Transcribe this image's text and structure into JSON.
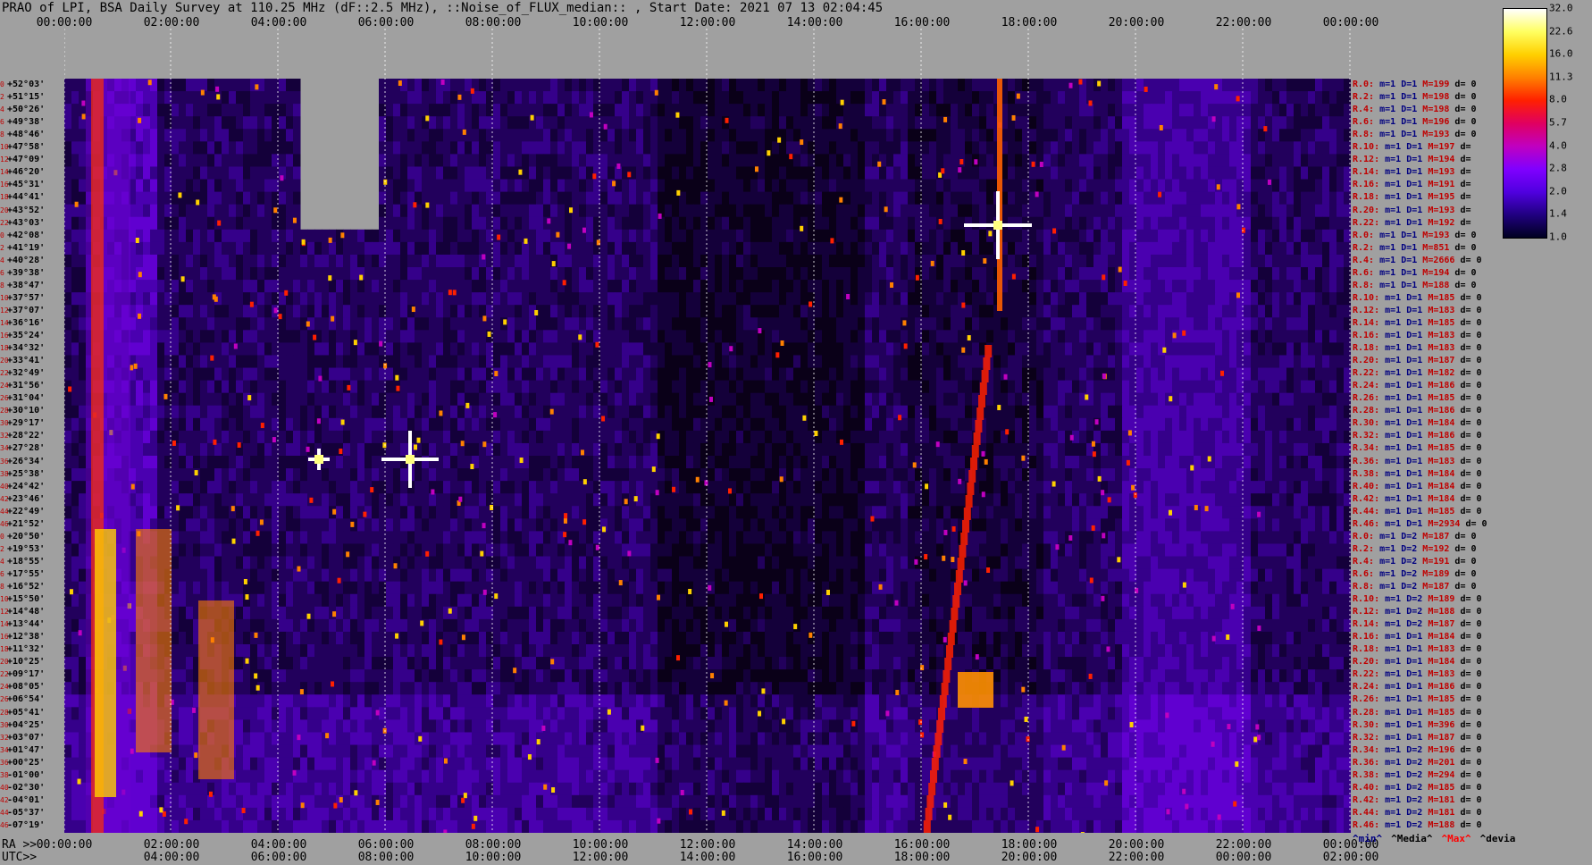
{
  "title": "PRAO of LPI, BSA Daily Survey at 110.25 MHz (dF::2.5 MHz), ::Noise_of_FLUX_median:: , Start Date: 2021 07 13 02:04:45",
  "chart_data": {
    "type": "heatmap",
    "title": "PRAO of LPI, BSA Daily Survey at 110.25 MHz (dF::2.5 MHz), ::Noise_of_FLUX_median:: , Start Date: 2021 07 13 02:04:45",
    "top_axis_ticks": [
      "00:00:00",
      "02:00:00",
      "04:00:00",
      "06:00:00",
      "08:00:00",
      "10:00:00",
      "12:00:00",
      "14:00:00",
      "16:00:00",
      "18:00:00",
      "20:00:00",
      "22:00:00",
      "00:00:00"
    ],
    "ra_prefix": "RA >>",
    "ra_axis_ticks": [
      "00:00:00",
      "02:00:00",
      "04:00:00",
      "06:00:00",
      "08:00:00",
      "10:00:00",
      "12:00:00",
      "14:00:00",
      "16:00:00",
      "18:00:00",
      "20:00:00",
      "22:00:00",
      "00:00:00"
    ],
    "utc_prefix": "UTC>>",
    "utc_axis_ticks": [
      "04:00:00",
      "06:00:00",
      "08:00:00",
      "10:00:00",
      "12:00:00",
      "14:00:00",
      "16:00:00",
      "18:00:00",
      "20:00:00",
      "22:00:00",
      "00:00:00",
      "02:00:00"
    ],
    "declinations": [
      "+52°03'",
      "+51°15'",
      "+50°26'",
      "+49°38'",
      "+48°46'",
      "+47°58'",
      "+47°09'",
      "+46°20'",
      "+45°31'",
      "+44°41'",
      "+43°52'",
      "+43°03'",
      "+42°08'",
      "+41°19'",
      "+40°28'",
      "+39°38'",
      "+38°47'",
      "+37°57'",
      "+37°07'",
      "+36°16'",
      "+35°24'",
      "+34°32'",
      "+33°41'",
      "+32°49'",
      "+31°56'",
      "+31°04'",
      "+30°10'",
      "+29°17'",
      "+28°22'",
      "+27°28'",
      "+26°34'",
      "+25°38'",
      "+24°42'",
      "+23°46'",
      "+22°49'",
      "+21°52'",
      "+20°50'",
      "+19°53'",
      "+18°55'",
      "+17°55'",
      "+16°52'",
      "+15°50'",
      "+14°48'",
      "+13°44'",
      "+12°38'",
      "+11°32'",
      "+10°25'",
      "+09°17'",
      "+08°05'",
      "+06°54'",
      "+05°41'",
      "+04°25'",
      "+03°07'",
      "+01°47'",
      "+00°25'",
      "-01°00'",
      "-02°30'",
      "-04°01'",
      "-05°37'",
      "-07°19'"
    ],
    "dec_indices": [
      "0",
      "2",
      "4",
      "6",
      "8",
      "10",
      "12",
      "14",
      "16",
      "18",
      "20",
      "22",
      "0",
      "2",
      "4",
      "6",
      "8",
      "10",
      "12",
      "14",
      "16",
      "18",
      "20",
      "22",
      "24",
      "26",
      "28",
      "30",
      "32",
      "34",
      "36",
      "38",
      "40",
      "42",
      "44",
      "46",
      "0",
      "2",
      "4",
      "6",
      "8",
      "10",
      "12",
      "14",
      "16",
      "18",
      "20",
      "22",
      "24",
      "26",
      "28",
      "30",
      "32",
      "34",
      "36",
      "38",
      "40",
      "42",
      "44",
      "46"
    ],
    "colorbar": {
      "labels": [
        "32.0",
        "22.6",
        "16.0",
        "11.3",
        "8.0",
        "5.7",
        "4.0",
        "2.8",
        "2.0",
        "1.4",
        "1.0"
      ],
      "colors": [
        "#ffffff",
        "#ffff60",
        "#ffd000",
        "#ff8000",
        "#ff2000",
        "#e00060",
        "#c000c0",
        "#8000ff",
        "#5000e0",
        "#200080",
        "#000020"
      ]
    },
    "stats": [
      {
        "r": "R.0:",
        "m": "m=1",
        "d": "D=1",
        "M": "M=199",
        "dv": "d= 0"
      },
      {
        "r": "R.2:",
        "m": "m=1",
        "d": "D=1",
        "M": "M=198",
        "dv": "d= 0"
      },
      {
        "r": "R.4:",
        "m": "m=1",
        "d": "D=1",
        "M": "M=198",
        "dv": "d= 0"
      },
      {
        "r": "R.6:",
        "m": "m=1",
        "d": "D=1",
        "M": "M=196",
        "dv": "d= 0"
      },
      {
        "r": "R.8:",
        "m": "m=1",
        "d": "D=1",
        "M": "M=193",
        "dv": "d= 0"
      },
      {
        "r": "R.10:",
        "m": "m=1",
        "d": "D=1",
        "M": "M=197",
        "dv": "d="
      },
      {
        "r": "R.12:",
        "m": "m=1",
        "d": "D=1",
        "M": "M=194",
        "dv": "d="
      },
      {
        "r": "R.14:",
        "m": "m=1",
        "d": "D=1",
        "M": "M=193",
        "dv": "d="
      },
      {
        "r": "R.16:",
        "m": "m=1",
        "d": "D=1",
        "M": "M=191",
        "dv": "d="
      },
      {
        "r": "R.18:",
        "m": "m=1",
        "d": "D=1",
        "M": "M=195",
        "dv": "d="
      },
      {
        "r": "R.20:",
        "m": "m=1",
        "d": "D=1",
        "M": "M=193",
        "dv": "d="
      },
      {
        "r": "R.22:",
        "m": "m=1",
        "d": "D=1",
        "M": "M=192",
        "dv": "d="
      },
      {
        "r": "R.0:",
        "m": "m=1",
        "d": "D=1",
        "M": "M=193",
        "dv": "d= 0"
      },
      {
        "r": "R.2:",
        "m": "m=1",
        "d": "D=1",
        "M": "M=851",
        "dv": "d= 0"
      },
      {
        "r": "R.4:",
        "m": "m=1",
        "d": "D=1",
        "M": "M=2666",
        "dv": "d= 0"
      },
      {
        "r": "R.6:",
        "m": "m=1",
        "d": "D=1",
        "M": "M=194",
        "dv": "d= 0"
      },
      {
        "r": "R.8:",
        "m": "m=1",
        "d": "D=1",
        "M": "M=188",
        "dv": "d= 0"
      },
      {
        "r": "R.10:",
        "m": "m=1",
        "d": "D=1",
        "M": "M=185",
        "dv": "d= 0"
      },
      {
        "r": "R.12:",
        "m": "m=1",
        "d": "D=1",
        "M": "M=183",
        "dv": "d= 0"
      },
      {
        "r": "R.14:",
        "m": "m=1",
        "d": "D=1",
        "M": "M=185",
        "dv": "d= 0"
      },
      {
        "r": "R.16:",
        "m": "m=1",
        "d": "D=1",
        "M": "M=183",
        "dv": "d= 0"
      },
      {
        "r": "R.18:",
        "m": "m=1",
        "d": "D=1",
        "M": "M=183",
        "dv": "d= 0"
      },
      {
        "r": "R.20:",
        "m": "m=1",
        "d": "D=1",
        "M": "M=187",
        "dv": "d= 0"
      },
      {
        "r": "R.22:",
        "m": "m=1",
        "d": "D=1",
        "M": "M=182",
        "dv": "d= 0"
      },
      {
        "r": "R.24:",
        "m": "m=1",
        "d": "D=1",
        "M": "M=186",
        "dv": "d= 0"
      },
      {
        "r": "R.26:",
        "m": "m=1",
        "d": "D=1",
        "M": "M=185",
        "dv": "d= 0"
      },
      {
        "r": "R.28:",
        "m": "m=1",
        "d": "D=1",
        "M": "M=186",
        "dv": "d= 0"
      },
      {
        "r": "R.30:",
        "m": "m=1",
        "d": "D=1",
        "M": "M=184",
        "dv": "d= 0"
      },
      {
        "r": "R.32:",
        "m": "m=1",
        "d": "D=1",
        "M": "M=186",
        "dv": "d= 0"
      },
      {
        "r": "R.34:",
        "m": "m=1",
        "d": "D=1",
        "M": "M=185",
        "dv": "d= 0"
      },
      {
        "r": "R.36:",
        "m": "m=1",
        "d": "D=1",
        "M": "M=183",
        "dv": "d= 0"
      },
      {
        "r": "R.38:",
        "m": "m=1",
        "d": "D=1",
        "M": "M=184",
        "dv": "d= 0"
      },
      {
        "r": "R.40:",
        "m": "m=1",
        "d": "D=1",
        "M": "M=184",
        "dv": "d= 0"
      },
      {
        "r": "R.42:",
        "m": "m=1",
        "d": "D=1",
        "M": "M=184",
        "dv": "d= 0"
      },
      {
        "r": "R.44:",
        "m": "m=1",
        "d": "D=1",
        "M": "M=185",
        "dv": "d= 0"
      },
      {
        "r": "R.46:",
        "m": "m=1",
        "d": "D=1",
        "M": "M=2934",
        "dv": "d= 0"
      },
      {
        "r": "R.0:",
        "m": "m=1",
        "d": "D=2",
        "M": "M=187",
        "dv": "d= 0"
      },
      {
        "r": "R.2:",
        "m": "m=1",
        "d": "D=2",
        "M": "M=192",
        "dv": "d= 0"
      },
      {
        "r": "R.4:",
        "m": "m=1",
        "d": "D=2",
        "M": "M=191",
        "dv": "d= 0"
      },
      {
        "r": "R.6:",
        "m": "m=1",
        "d": "D=2",
        "M": "M=189",
        "dv": "d= 0"
      },
      {
        "r": "R.8:",
        "m": "m=1",
        "d": "D=2",
        "M": "M=187",
        "dv": "d= 0"
      },
      {
        "r": "R.10:",
        "m": "m=1",
        "d": "D=2",
        "M": "M=189",
        "dv": "d= 0"
      },
      {
        "r": "R.12:",
        "m": "m=1",
        "d": "D=2",
        "M": "M=188",
        "dv": "d= 0"
      },
      {
        "r": "R.14:",
        "m": "m=1",
        "d": "D=2",
        "M": "M=187",
        "dv": "d= 0"
      },
      {
        "r": "R.16:",
        "m": "m=1",
        "d": "D=1",
        "M": "M=184",
        "dv": "d= 0"
      },
      {
        "r": "R.18:",
        "m": "m=1",
        "d": "D=1",
        "M": "M=183",
        "dv": "d= 0"
      },
      {
        "r": "R.20:",
        "m": "m=1",
        "d": "D=1",
        "M": "M=184",
        "dv": "d= 0"
      },
      {
        "r": "R.22:",
        "m": "m=1",
        "d": "D=1",
        "M": "M=183",
        "dv": "d= 0"
      },
      {
        "r": "R.24:",
        "m": "m=1",
        "d": "D=1",
        "M": "M=186",
        "dv": "d= 0"
      },
      {
        "r": "R.26:",
        "m": "m=1",
        "d": "D=1",
        "M": "M=185",
        "dv": "d= 0"
      },
      {
        "r": "R.28:",
        "m": "m=1",
        "d": "D=1",
        "M": "M=185",
        "dv": "d= 0"
      },
      {
        "r": "R.30:",
        "m": "m=1",
        "d": "D=1",
        "M": "M=396",
        "dv": "d= 0"
      },
      {
        "r": "R.32:",
        "m": "m=1",
        "d": "D=1",
        "M": "M=187",
        "dv": "d= 0"
      },
      {
        "r": "R.34:",
        "m": "m=1",
        "d": "D=2",
        "M": "M=196",
        "dv": "d= 0"
      },
      {
        "r": "R.36:",
        "m": "m=1",
        "d": "D=2",
        "M": "M=201",
        "dv": "d= 0"
      },
      {
        "r": "R.38:",
        "m": "m=1",
        "d": "D=2",
        "M": "M=294",
        "dv": "d= 0"
      },
      {
        "r": "R.40:",
        "m": "m=1",
        "d": "D=2",
        "M": "M=185",
        "dv": "d= 0"
      },
      {
        "r": "R.42:",
        "m": "m=1",
        "d": "D=2",
        "M": "M=181",
        "dv": "d= 0"
      },
      {
        "r": "R.44:",
        "m": "m=1",
        "d": "D=2",
        "M": "M=181",
        "dv": "d= 0"
      },
      {
        "r": "R.46:",
        "m": "m=1",
        "d": "D=2",
        "M": "M=188",
        "dv": "d= 0"
      }
    ],
    "legend_bottom": [
      "^min^",
      "^Media^",
      "^Max^",
      "^devia"
    ],
    "legend_colors": [
      "#000080",
      "#000000",
      "#ff0000",
      "#000000"
    ]
  }
}
